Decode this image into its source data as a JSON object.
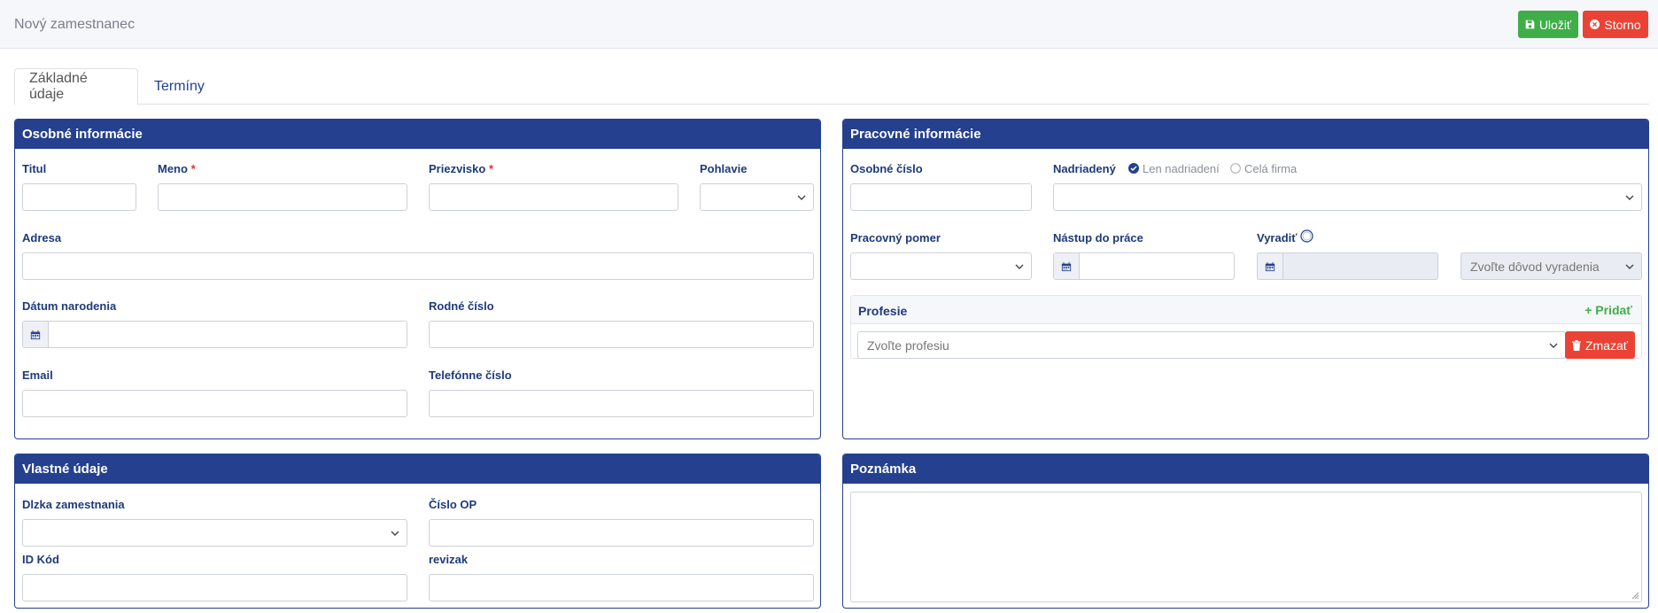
{
  "header": {
    "title": "Nový zamestnanec",
    "save_label": "Uložiť",
    "cancel_label": "Storno"
  },
  "tabs": [
    {
      "label": "Základné údaje",
      "active": true
    },
    {
      "label": "Termíny",
      "active": false
    }
  ],
  "personal": {
    "title": "Osobné informácie",
    "titul_label": "Titul",
    "meno_label": "Meno",
    "priezvisko_label": "Priezvisko",
    "pohlavie_label": "Pohlavie",
    "adresa_label": "Adresa",
    "datum_label": "Dátum narodenia",
    "rodne_label": "Rodné číslo",
    "email_label": "Email",
    "telefon_label": "Telefónne číslo",
    "required_mark": "*"
  },
  "work": {
    "title": "Pracovné informácie",
    "osobne_cislo_label": "Osobné číslo",
    "nadriadeny_label": "Nadriadený",
    "radio_len": "Len nadriadení",
    "radio_cela": "Celá firma",
    "pomer_label": "Pracovný pomer",
    "nastup_label": "Nástup do práce",
    "vyradit_label": "Vyradiť",
    "dovod_placeholder": "Zvoľte dôvod vyradenia",
    "profesie_title": "Profesie",
    "pridat_label": "Pridať",
    "profesia_placeholder": "Zvoľte profesiu",
    "zmazat_label": "Zmazať"
  },
  "custom": {
    "title": "Vlastné údaje",
    "dlzka_label": "Dlzka zamestnania",
    "cislo_op_label": "Číslo OP",
    "id_kod_label": "ID Kód",
    "revizak_label": "revizak"
  },
  "note": {
    "title": "Poznámka"
  },
  "colors": {
    "primary": "#24408e",
    "success": "#3fae49",
    "danger": "#ea4335"
  }
}
